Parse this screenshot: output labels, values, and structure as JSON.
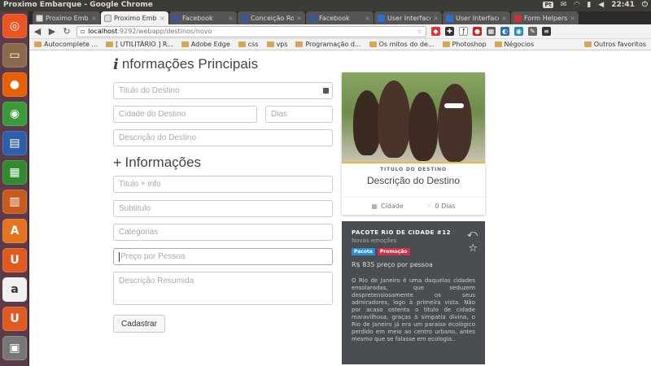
{
  "window": {
    "title": "Proximo Embarque - Google Chrome",
    "clock": "22:41",
    "keyboard": "Pt"
  },
  "launcher": {
    "items": [
      {
        "name": "ubuntu-icon",
        "glyph": "◎",
        "color": "#e95420"
      },
      {
        "name": "files-icon",
        "glyph": "▭",
        "color": "#8a6a4a"
      },
      {
        "name": "firefox-icon",
        "glyph": "●",
        "color": "#e66000"
      },
      {
        "name": "chrome-icon",
        "glyph": "◉",
        "color": "#3a9a3a"
      },
      {
        "name": "writer-icon",
        "glyph": "▤",
        "color": "#2d5fa8"
      },
      {
        "name": "calc-icon",
        "glyph": "▦",
        "color": "#2e8b2e"
      },
      {
        "name": "impress-icon",
        "glyph": "▥",
        "color": "#c85a1e"
      },
      {
        "name": "software-center-icon",
        "glyph": "A",
        "color": "#e8731e"
      },
      {
        "name": "ubuntu-one-icon",
        "glyph": "U",
        "color": "#e05a20"
      },
      {
        "name": "amazon-icon",
        "glyph": "a",
        "color": "#f0f0f0"
      },
      {
        "name": "ubuntu-one-music-icon",
        "glyph": "U",
        "color": "#e05a20"
      },
      {
        "name": "scanner-icon",
        "glyph": "▣",
        "color": "#777"
      }
    ]
  },
  "tabs": [
    {
      "label": "Proximo Embarque",
      "fav": "doc",
      "active": false
    },
    {
      "label": "Proximo Embarq",
      "fav": "doc",
      "active": true
    },
    {
      "label": "Facebook",
      "fav": "fb",
      "active": false
    },
    {
      "label": "Conceição Rodrigu",
      "fav": "fb",
      "active": false
    },
    {
      "label": "Facebook",
      "fav": "fb",
      "active": false
    },
    {
      "label": "User Interface UI K",
      "fav": "g",
      "active": false
    },
    {
      "label": "User Interface UI K",
      "fav": "g",
      "active": false
    },
    {
      "label": "Form Helpers — Ru",
      "fav": "rails",
      "active": false
    }
  ],
  "omnibox": {
    "host": "localhost",
    "path": ":9292/webapp/destinos/novo"
  },
  "bookmarks": {
    "items": [
      "Autocomplete ...",
      "[ UTILITÁRIO ] R...",
      "Adobe Edge",
      "css",
      "vps",
      "Programação d...",
      "Os mitos do de...",
      "Photoshop",
      "Négocios"
    ],
    "other": "Outros favoritos"
  },
  "form": {
    "section1": {
      "glyph": "i",
      "title": "nformações Principais"
    },
    "titulo_placeholder": "Titulo do Destino",
    "cidade_placeholder": "Cidade do Destino",
    "dias_placeholder": "Dias",
    "descricao_placeholder": "Descrição do Destino",
    "section2": {
      "glyph": "+",
      "title": "Informações"
    },
    "titulo_info_placeholder": "Titulo + info",
    "subtitulo_placeholder": "Subtitulo",
    "categorias_placeholder": "Categorias",
    "preco_placeholder": "Preço por Pessoa",
    "resumo_placeholder": "Descrição Resumida",
    "submit_label": "Cadastrar"
  },
  "card": {
    "label": "TITULO DO DESTINO",
    "description": "Descrição do Destino",
    "city": "Cidade",
    "days": "0 Dias"
  },
  "package": {
    "title": "PACOTE RIO DE CIDADE #12",
    "subtitle": "Novas emoções",
    "tag1": "Pacote",
    "tag2": "Promoção",
    "price": "R$ 835 preço por pessoa",
    "body": "O Rio de Janeiro é uma daquelas cidades ensolaradas, que seduzem despretensiosamente os seus admiradores, logo à primeira vista. Não por acaso ostenta o título de cidade maravilhosa, graças à simpatia divina, o Rio de Janeiro já era um paraíso ecológico perdido em meio ao centro urbano, antes mesmo que se falasse em ecologia.."
  },
  "colors": {
    "tag_pacote": "#2b8fd6",
    "tag_promocao": "#d0304a",
    "stripe": "#f3b63b"
  }
}
